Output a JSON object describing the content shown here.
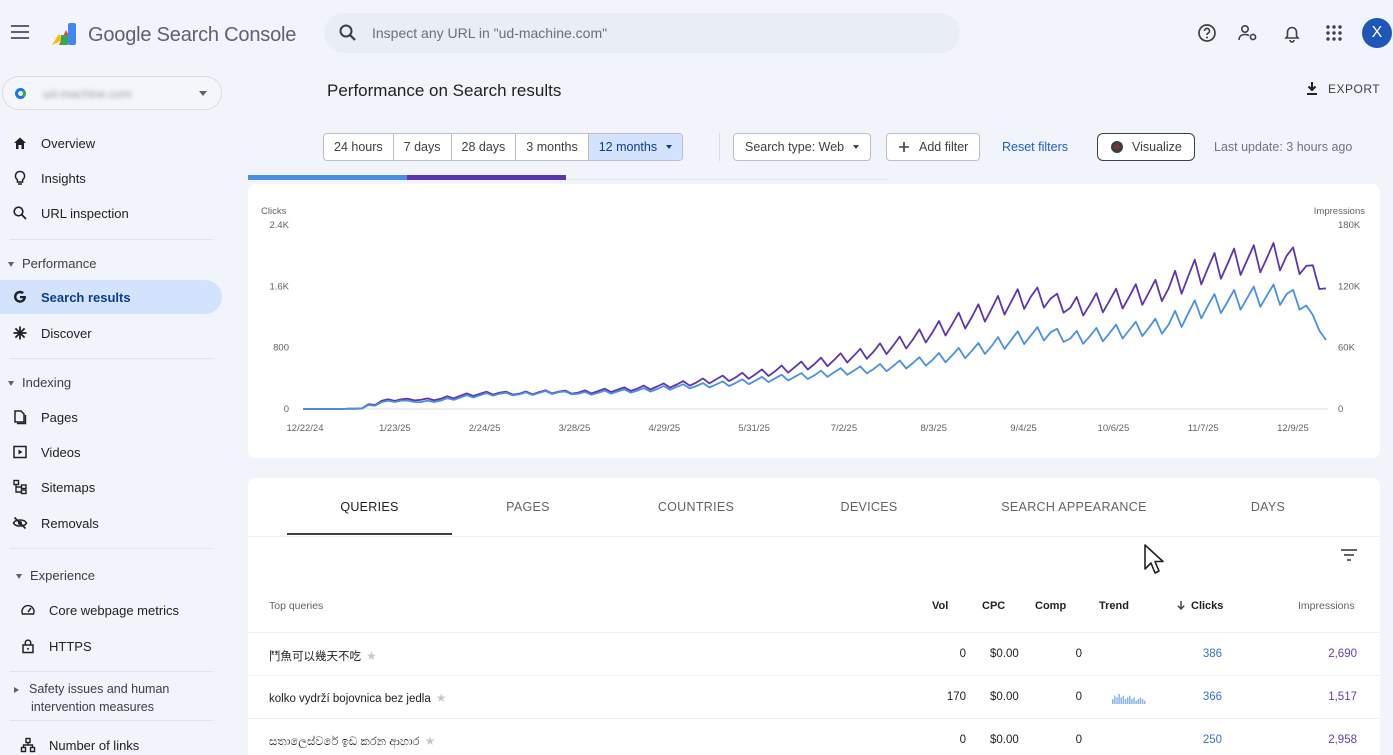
{
  "app": {
    "title": "Google Search Console"
  },
  "search": {
    "placeholder": "Inspect any URL in \"ud-machine.com\""
  },
  "topbar_icons": [
    "help-icon",
    "account-settings-icon",
    "notifications-icon",
    "apps-grid-icon"
  ],
  "user": {
    "avatar_letter": "X"
  },
  "property": {
    "name": "ud-machine.com"
  },
  "sidebar": {
    "items": [
      {
        "label": "Overview",
        "icon": "home-icon"
      },
      {
        "label": "Insights",
        "icon": "lightbulb-icon"
      },
      {
        "label": "URL inspection",
        "icon": "search-icon"
      }
    ],
    "performance": {
      "label": "Performance",
      "items": [
        {
          "label": "Search results",
          "icon": "google-g-icon",
          "active": true
        },
        {
          "label": "Discover",
          "icon": "asterisk-icon"
        }
      ]
    },
    "indexing": {
      "label": "Indexing",
      "items": [
        {
          "label": "Pages",
          "icon": "pages-icon"
        },
        {
          "label": "Videos",
          "icon": "video-icon"
        },
        {
          "label": "Sitemaps",
          "icon": "sitemap-icon"
        },
        {
          "label": "Removals",
          "icon": "removals-icon"
        }
      ]
    },
    "experience": {
      "label": "Experience",
      "items": [
        {
          "label": "Core webpage metrics",
          "icon": "gauge-icon"
        },
        {
          "label": "HTTPS",
          "icon": "lock-icon"
        }
      ]
    },
    "safety": {
      "label_line1": "Safety issues and human",
      "label_line2": "intervention measures"
    },
    "links": {
      "label": "Number of links",
      "icon": "links-icon"
    }
  },
  "main": {
    "title": "Performance on Search results",
    "export_label": "EXPORT",
    "date_ranges": [
      "24 hours",
      "7 days",
      "28 days",
      "3 months",
      "12 months"
    ],
    "active_range": "12 months",
    "search_type": "Search type: Web",
    "add_filter": "Add filter",
    "reset_filters": "Reset filters",
    "visualize": "Visualize",
    "last_update": "Last update: 3 hours ago"
  },
  "colors": {
    "clicks": "#4a90e2",
    "impressions": "#5e35b1",
    "accent": "#1a73e8",
    "active_bg": "#d3e3fd"
  },
  "chart_data": {
    "type": "line",
    "ylabel_left": "Clicks",
    "ylabel_right": "Impressions",
    "yticks_left": [
      "0",
      "800",
      "1.6K",
      "2.4K"
    ],
    "yticks_right": [
      "0",
      "60K",
      "120K",
      "180K"
    ],
    "ylim_left": [
      0,
      2400
    ],
    "ylim_right": [
      0,
      180000
    ],
    "x_tick_labels": [
      "12/22/24",
      "1/23/25",
      "2/24/25",
      "3/28/25",
      "4/29/25",
      "5/31/25",
      "7/2/25",
      "8/3/25",
      "9/4/25",
      "10/6/25",
      "11/7/25",
      "12/9/25"
    ],
    "x": [
      "12/22/24",
      "12/29/24",
      "1/5/25",
      "1/12/25",
      "1/19/25",
      "1/26/25",
      "2/2/25",
      "2/9/25",
      "2/16/25",
      "2/23/25",
      "3/2/25",
      "3/9/25",
      "3/16/25",
      "3/23/25",
      "3/30/25",
      "4/6/25",
      "4/13/25",
      "4/20/25",
      "4/27/25",
      "5/4/25",
      "5/11/25",
      "5/18/25",
      "5/25/25",
      "6/1/25",
      "6/8/25",
      "6/15/25",
      "6/22/25",
      "6/29/25",
      "7/6/25",
      "7/13/25",
      "7/20/25",
      "7/27/25",
      "8/3/25",
      "8/10/25",
      "8/17/25",
      "8/24/25",
      "8/31/25",
      "9/7/25",
      "9/14/25",
      "9/21/25",
      "9/28/25",
      "10/5/25",
      "10/12/25",
      "10/19/25",
      "10/26/25",
      "11/2/25",
      "11/9/25",
      "11/16/25",
      "11/23/25",
      "11/30/25",
      "12/7/25",
      "12/14/25",
      "12/21/25"
    ],
    "series": [
      {
        "name": "Clicks",
        "axis": "left",
        "values": [
          0,
          0,
          0,
          5,
          90,
          110,
          90,
          110,
          150,
          180,
          200,
          190,
          210,
          220,
          200,
          210,
          230,
          240,
          260,
          290,
          300,
          320,
          340,
          370,
          400,
          420,
          440,
          480,
          500,
          520,
          560,
          600,
          640,
          700,
          760,
          820,
          900,
          960,
          1000,
          920,
          950,
          990,
          1030,
          1060,
          1100,
          1250,
          1350,
          1400,
          1450,
          1480,
          1500,
          1350,
          900
        ]
      },
      {
        "name": "Impressions",
        "axis": "right",
        "values": [
          0,
          0,
          0,
          600,
          8000,
          9500,
          9000,
          10000,
          13000,
          15000,
          16000,
          15000,
          16500,
          17000,
          16000,
          17500,
          19000,
          20000,
          22000,
          24000,
          26000,
          29000,
          31000,
          34000,
          37000,
          41000,
          44000,
          48000,
          52000,
          56000,
          62000,
          68000,
          75000,
          83000,
          90000,
          98000,
          105000,
          110000,
          108000,
          99000,
          102000,
          106000,
          110000,
          114000,
          118000,
          130000,
          138000,
          142000,
          146000,
          148000,
          150000,
          140000,
          118000
        ]
      }
    ],
    "grid": false,
    "legend": "none"
  },
  "table": {
    "tabs": [
      "QUERIES",
      "PAGES",
      "COUNTRIES",
      "DEVICES",
      "SEARCH APPEARANCE",
      "DAYS"
    ],
    "active_tab": "QUERIES",
    "columns": {
      "query": "Top queries",
      "vol": "Vol",
      "cpc": "CPC",
      "comp": "Comp",
      "trend": "Trend",
      "clicks": "Clicks",
      "impressions": "Impressions"
    },
    "rows": [
      {
        "query": "鬥魚可以幾天不吃",
        "vol": "0",
        "cpc": "$0.00",
        "comp": "0",
        "clicks": "386",
        "impressions": "2,690",
        "trend": []
      },
      {
        "query": "kolko vydrží bojovnica bez jedla",
        "vol": "170",
        "cpc": "$0.00",
        "comp": "0",
        "clicks": "366",
        "impressions": "1,517",
        "trend": [
          3,
          5,
          4,
          6,
          4,
          5,
          3,
          4,
          5,
          3,
          4,
          2,
          3,
          4,
          3,
          2
        ]
      },
      {
        "query": "සතාලෙස්වරේ ඉඩ කරන ආහාර",
        "vol": "0",
        "cpc": "$0.00",
        "comp": "0",
        "clicks": "250",
        "impressions": "2,958",
        "trend": []
      }
    ]
  }
}
